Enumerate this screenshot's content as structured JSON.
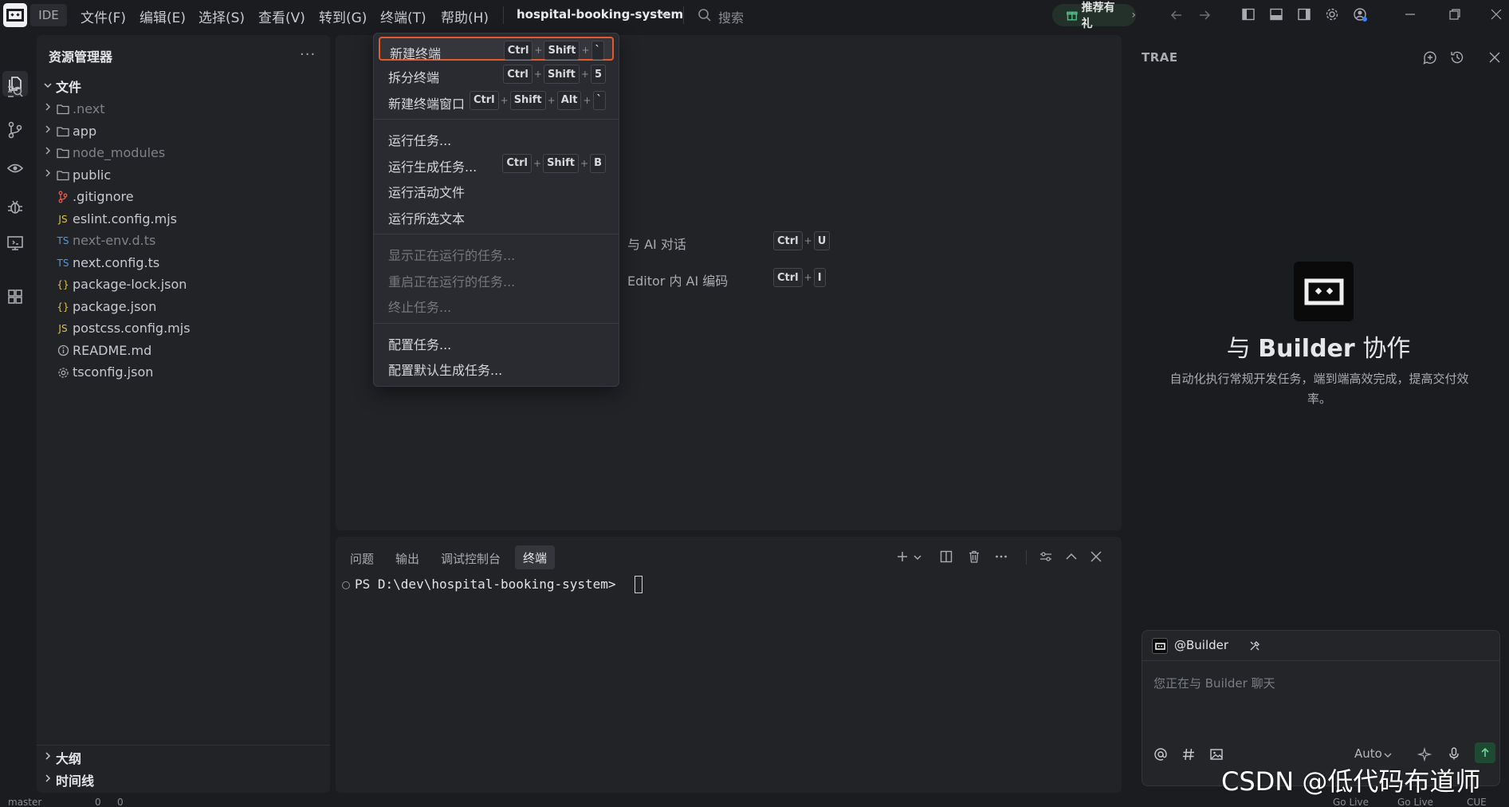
{
  "titlebar": {
    "ide_label": "IDE",
    "menus": [
      "文件(F)",
      "编辑(E)",
      "选择(S)",
      "查看(V)",
      "转到(G)",
      "终端(T)",
      "帮助(H)"
    ],
    "project_name": "hospital-booking-system",
    "search_label": "搜索",
    "gift_label": "推荐有礼"
  },
  "explorer": {
    "title": "资源管理器",
    "more": "···",
    "section": "文件",
    "items": [
      {
        "name": ".next",
        "type": "folder",
        "icon": "folder-icon",
        "dim": true
      },
      {
        "name": "app",
        "type": "folder",
        "icon": "folder-icon",
        "dim": false
      },
      {
        "name": "node_modules",
        "type": "folder",
        "icon": "folder-icon",
        "dim": true
      },
      {
        "name": "public",
        "type": "folder",
        "icon": "folder-icon",
        "dim": false
      },
      {
        "name": ".gitignore",
        "type": "file",
        "icon": "git-icon",
        "badge": "",
        "dim": false
      },
      {
        "name": "eslint.config.mjs",
        "type": "file",
        "icon": "js-icon",
        "badge": "JS",
        "dim": false
      },
      {
        "name": "next-env.d.ts",
        "type": "file",
        "icon": "ts-icon",
        "badge": "TS",
        "dim": true
      },
      {
        "name": "next.config.ts",
        "type": "file",
        "icon": "ts-icon",
        "badge": "TS",
        "dim": false
      },
      {
        "name": "package-lock.json",
        "type": "file",
        "icon": "json-icon",
        "badge": "{}",
        "dim": false
      },
      {
        "name": "package.json",
        "type": "file",
        "icon": "json-icon",
        "badge": "{}",
        "dim": false
      },
      {
        "name": "postcss.config.mjs",
        "type": "file",
        "icon": "js-icon",
        "badge": "JS",
        "dim": false
      },
      {
        "name": "README.md",
        "type": "file",
        "icon": "info-icon",
        "badge": "",
        "dim": false
      },
      {
        "name": "tsconfig.json",
        "type": "file",
        "icon": "gear-icon",
        "badge": "",
        "dim": false
      }
    ],
    "outline": "大纲",
    "timeline": "时间线"
  },
  "terminal_menu": {
    "groups": [
      [
        {
          "label": "新建终端",
          "keys": [
            "Ctrl",
            "Shift",
            "`"
          ],
          "active": true,
          "disabled": false
        },
        {
          "label": "拆分终端",
          "keys": [
            "Ctrl",
            "Shift",
            "5"
          ],
          "active": false,
          "disabled": false
        },
        {
          "label": "新建终端窗口",
          "keys": [
            "Ctrl",
            "Shift",
            "Alt",
            "`"
          ],
          "active": false,
          "disabled": false
        }
      ],
      [
        {
          "label": "运行任务...",
          "keys": [],
          "active": false,
          "disabled": false
        },
        {
          "label": "运行生成任务...",
          "keys": [
            "Ctrl",
            "Shift",
            "B"
          ],
          "active": false,
          "disabled": false
        },
        {
          "label": "运行活动文件",
          "keys": [],
          "active": false,
          "disabled": false
        },
        {
          "label": "运行所选文本",
          "keys": [],
          "active": false,
          "disabled": false
        }
      ],
      [
        {
          "label": "显示正在运行的任务...",
          "keys": [],
          "active": false,
          "disabled": true
        },
        {
          "label": "重启正在运行的任务...",
          "keys": [],
          "active": false,
          "disabled": true
        },
        {
          "label": "终止任务...",
          "keys": [],
          "active": false,
          "disabled": true
        }
      ],
      [
        {
          "label": "配置任务...",
          "keys": [],
          "active": false,
          "disabled": false
        },
        {
          "label": "配置默认生成任务...",
          "keys": [],
          "active": false,
          "disabled": false
        }
      ]
    ]
  },
  "welcome": {
    "shortcuts": [
      {
        "label": "与 AI 对话",
        "keys": [
          "Ctrl",
          "U"
        ]
      },
      {
        "label": "Editor 内 AI 编码",
        "keys": [
          "Ctrl",
          "I"
        ]
      }
    ]
  },
  "panel": {
    "tabs": [
      "问题",
      "输出",
      "调试控制台",
      "终端"
    ],
    "prompt": "PS D:\\dev\\hospital-booking-system> "
  },
  "right_panel": {
    "title": "TRAE",
    "builder_prefix": "与",
    "builder_name": "Builder",
    "builder_suffix": "协作",
    "description": "自动化执行常规开发任务，端到端高效完成，提高交付效率。",
    "chat_agent": "@Builder",
    "chat_placeholder": "您正在与 Builder 聊天",
    "model": "Auto"
  },
  "statusbar": {
    "branch": "master",
    "errors": "0",
    "warnings": "0",
    "golive1": "Go Live",
    "golive2": "Go Live",
    "encoding": "CUE"
  },
  "watermark": "CSDN @低代码布道师",
  "colors": {
    "accent_highlight": "#e55a2d",
    "send_button": "#1e4a33"
  }
}
